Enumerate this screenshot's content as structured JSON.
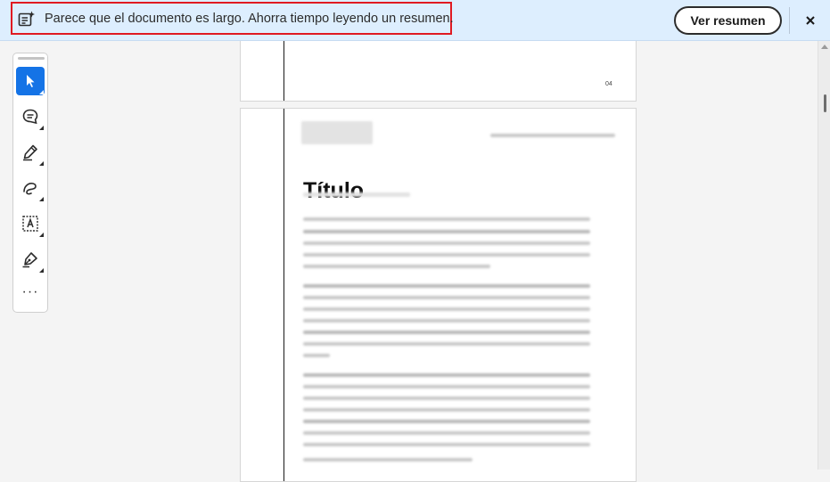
{
  "banner": {
    "message": "Parece que el documento es largo. Ahorra tiempo leyendo un resumen.",
    "summary_button": "Ver resumen",
    "close_label": "×"
  },
  "toolbar": {
    "tools": [
      {
        "name": "select-tool",
        "icon": "cursor-arrow-icon",
        "active": true
      },
      {
        "name": "comment-tool",
        "icon": "comment-bubble-icon",
        "active": false
      },
      {
        "name": "highlight-tool",
        "icon": "highlighter-pen-icon",
        "active": false
      },
      {
        "name": "draw-tool",
        "icon": "freehand-loop-icon",
        "active": false
      },
      {
        "name": "text-select-tool",
        "icon": "text-box-icon",
        "active": false
      },
      {
        "name": "sign-tool",
        "icon": "fountain-pen-icon",
        "active": false
      },
      {
        "name": "more-tools",
        "icon": "more-dots-icon",
        "active": false
      }
    ],
    "more_label": "···"
  },
  "document": {
    "previous_page_number": "04",
    "title": "Título"
  },
  "colors": {
    "banner_bg": "#ddeefe",
    "highlight_border": "#e01a22",
    "active_tool": "#1473e6"
  }
}
